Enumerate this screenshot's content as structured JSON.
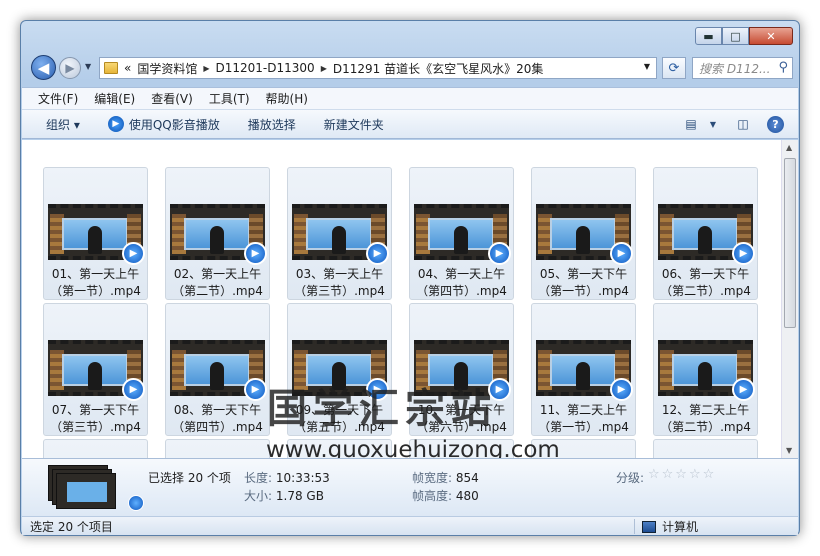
{
  "window": {
    "controls": {
      "minimize": "▬",
      "maximize": "□",
      "close": "✕"
    }
  },
  "nav": {
    "back_icon": "back-arrow-icon",
    "address_prefix": "«",
    "breadcrumbs": [
      "国学资料馆",
      "D11201-D11300",
      "D11291 苗道长《玄空飞星风水》20集"
    ],
    "search_placeholder": "搜索 D112..."
  },
  "menu": [
    "文件(F)",
    "编辑(E)",
    "查看(V)",
    "工具(T)",
    "帮助(H)"
  ],
  "toolbar": {
    "organize": "组织 ▾",
    "play_qq": "使用QQ影音播放",
    "play_select": "播放选择",
    "new_folder": "新建文件夹"
  },
  "files": [
    {
      "line1": "01、第一天上午",
      "line2": "（第一节）.mp4"
    },
    {
      "line1": "02、第一天上午",
      "line2": "（第二节）.mp4"
    },
    {
      "line1": "03、第一天上午",
      "line2": "（第三节）.mp4"
    },
    {
      "line1": "04、第一天上午",
      "line2": "（第四节）.mp4"
    },
    {
      "line1": "05、第一天下午",
      "line2": "（第一节）.mp4"
    },
    {
      "line1": "06、第一天下午",
      "line2": "（第二节）.mp4"
    },
    {
      "line1": "07、第一天下午",
      "line2": "（第三节）.mp4"
    },
    {
      "line1": "08、第一天下午",
      "line2": "（第四节）.mp4"
    },
    {
      "line1": "09、第一天下午",
      "line2": "（第五节）.mp4"
    },
    {
      "line1": "10、第一天下午",
      "line2": "（第六节）.mp4"
    },
    {
      "line1": "11、第二天上午",
      "line2": "（第一节）.mp4"
    },
    {
      "line1": "12、第二天上午",
      "line2": "（第二节）.mp4"
    },
    {
      "line1": "",
      "line2": ""
    },
    {
      "line1": "",
      "line2": ""
    },
    {
      "line1": "",
      "line2": ""
    },
    {
      "line1": "",
      "line2": ""
    },
    {
      "line1": "",
      "line2": ""
    },
    {
      "line1": "",
      "line2": ""
    }
  ],
  "watermark": {
    "cn": "国学汇宗站",
    "url": "www.guoxuehuizong.com"
  },
  "details": {
    "selected": "已选择 20 个项",
    "length_label": "长度:",
    "length_value": "10:33:53",
    "size_label": "大小:",
    "size_value": "1.78 GB",
    "frame_width_label": "帧宽度:",
    "frame_width_value": "854",
    "frame_height_label": "帧高度:",
    "frame_height_value": "480",
    "rating_label": "分级:",
    "rating_stars": "☆☆☆☆☆"
  },
  "status": {
    "selected": "选定 20 个项目",
    "computer": "计算机"
  }
}
